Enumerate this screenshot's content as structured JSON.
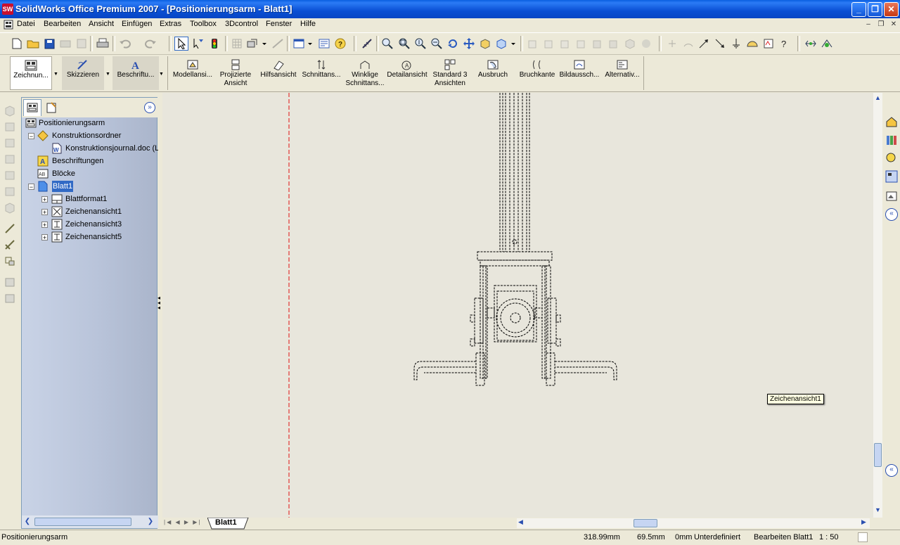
{
  "window": {
    "title": "SolidWorks Office Premium 2007 - [Positionierungsarm - Blatt1]",
    "app_icon": "SW",
    "buttons": [
      "minimize-icon",
      "restore-icon",
      "close-icon"
    ]
  },
  "menubar": {
    "items": [
      "Datei",
      "Bearbeiten",
      "Ansicht",
      "Einfügen",
      "Extras",
      "Toolbox",
      "3Dcontrol",
      "Fenster",
      "Hilfe"
    ]
  },
  "command_manager": {
    "groups": [
      "Zeichnun...",
      "Skizzieren",
      "Beschriftu..."
    ],
    "buttons": [
      {
        "label1": "Modellansi...",
        "label2": ""
      },
      {
        "label1": "Projizierte",
        "label2": "Ansicht"
      },
      {
        "label1": "Hilfsansicht",
        "label2": ""
      },
      {
        "label1": "Schnittans...",
        "label2": ""
      },
      {
        "label1": "Winklige",
        "label2": "Schnittans..."
      },
      {
        "label1": "Detailansicht",
        "label2": ""
      },
      {
        "label1": "Standard 3",
        "label2": "Ansichten"
      },
      {
        "label1": "Ausbruch",
        "label2": ""
      },
      {
        "label1": "Bruchkante",
        "label2": ""
      },
      {
        "label1": "Bildaussch...",
        "label2": ""
      },
      {
        "label1": "Alternativ...",
        "label2": ""
      }
    ]
  },
  "feature_tree": {
    "root": "Positionierungsarm",
    "items": [
      {
        "label": "Konstruktionsordner",
        "icon": "folder-icon"
      },
      {
        "label": "Konstruktionsjournal.doc (L",
        "icon": "word-doc-icon"
      },
      {
        "label": "Beschriftungen",
        "icon": "annotations-icon"
      },
      {
        "label": "Blöcke",
        "icon": "blocks-icon"
      },
      {
        "label": "Blatt1",
        "icon": "sheet-icon"
      },
      {
        "label": "Blattformat1",
        "icon": "sheet-format-icon"
      },
      {
        "label": "Zeichenansicht1",
        "icon": "drawing-view-icon"
      },
      {
        "label": "Zeichenansicht3",
        "icon": "drawing-view-icon"
      },
      {
        "label": "Zeichenansicht5",
        "icon": "drawing-view-icon"
      }
    ]
  },
  "canvas": {
    "tooltip": "Zeichenansicht1"
  },
  "sheet_tabs": {
    "active": "Blatt1"
  },
  "statusbar": {
    "document": "Positionierungsarm",
    "x": "318.99mm",
    "y": "69.5mm",
    "z": "0mm",
    "state": "Unterdefiniert",
    "mode": "Bearbeiten Blatt1",
    "scale": "1 : 50"
  },
  "colors": {
    "title_blue": "#0a4fd4",
    "selection": "#316ac5",
    "sheet_border": "#e01010"
  }
}
